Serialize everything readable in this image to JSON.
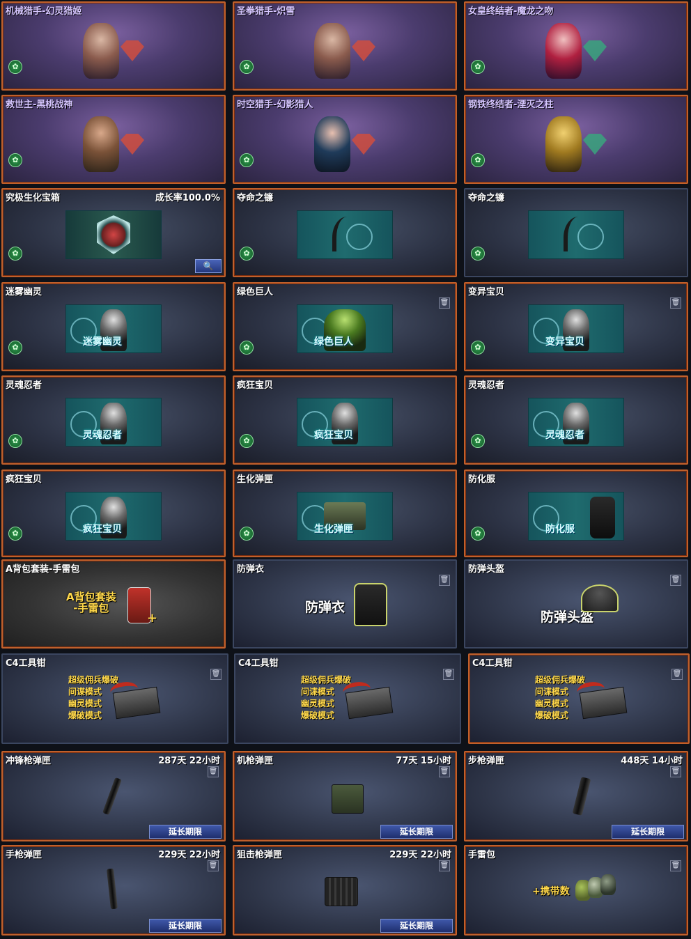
{
  "colors": {
    "border": "#6e3a26",
    "selected_border": "#c0602c",
    "tag_green": "#2f9b4f",
    "button_blue": "#3f58aa"
  },
  "cards": [
    {
      "title": "机械猎手-幻灵猎姬"
    },
    {
      "title": "圣拳猎手-炽雪"
    },
    {
      "title": "女皇终结者-魔龙之吻"
    },
    {
      "title": "救世主-黑桃战神"
    },
    {
      "title": "时空猎手-幻影猎人"
    },
    {
      "title": "钢铁终结者-湮灭之柱"
    },
    {
      "title": "究极生化宝箱",
      "rate": "成长率100.0%"
    },
    {
      "title": "夺命之镰"
    },
    {
      "title": "夺命之镰"
    },
    {
      "title": "迷雾幽灵",
      "art_label": "迷雾幽灵"
    },
    {
      "title": "绿色巨人",
      "art_label": "绿色巨人"
    },
    {
      "title": "变异宝贝",
      "art_label": "变异宝贝"
    },
    {
      "title": "灵魂忍者",
      "art_label": "灵魂忍者"
    },
    {
      "title": "疯狂宝贝",
      "art_label": "疯狂宝贝"
    },
    {
      "title": "灵魂忍者",
      "art_label": "灵魂忍者"
    },
    {
      "title": "疯狂宝贝",
      "art_label": "疯狂宝贝"
    },
    {
      "title": "生化弹匣",
      "art_label": "生化弹匣"
    },
    {
      "title": "防化服",
      "art_label": "防化服"
    },
    {
      "title": "A背包套装-手雷包",
      "art_line1": "A背包套装",
      "art_line2": "-手雷包"
    },
    {
      "title": "防弹衣",
      "art_label": "防弹衣"
    },
    {
      "title": "防弹头盔",
      "art_label": "防弹头盔"
    },
    {
      "title": "C4工具钳"
    },
    {
      "title": "C4工具钳"
    },
    {
      "title": "C4工具钳"
    },
    {
      "title": "冲锋枪弹匣",
      "ttl": "287天 22小时"
    },
    {
      "title": "机枪弹匣",
      "ttl": "77天 15小时"
    },
    {
      "title": "步枪弹匣",
      "ttl": "448天 14小时"
    },
    {
      "title": "手枪弹匣",
      "ttl": "229天 22小时"
    },
    {
      "title": "狙击枪弹匣",
      "ttl": "229天 22小时"
    },
    {
      "title": "手雷包",
      "art_label": "+携带数"
    }
  ],
  "c4_modes": [
    "超级佣兵爆破",
    "间谍模式",
    "幽灵模式",
    "爆破模式"
  ],
  "extend_label": "延长期限",
  "icons": {
    "search": "magnifier-icon",
    "trash": "trash-icon",
    "tag": "bio-tag-icon"
  }
}
